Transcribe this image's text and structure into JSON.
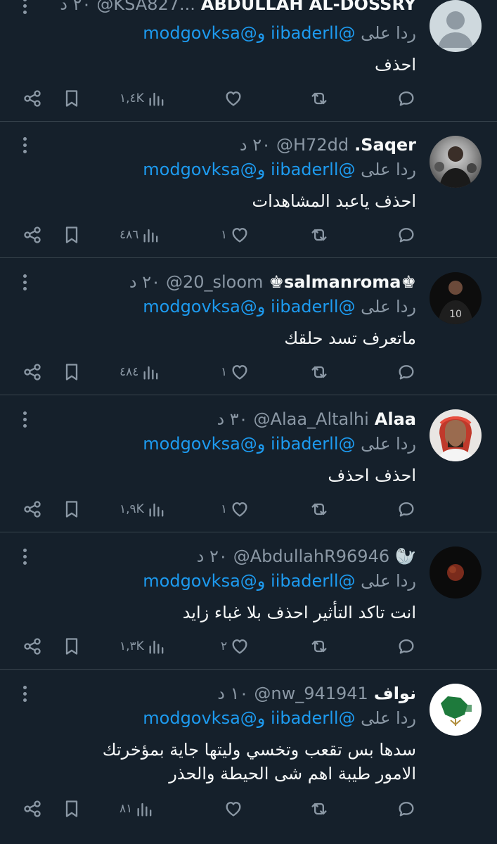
{
  "reply_label": "ردا على",
  "mention_1": "@iibaderll",
  "mention_joiner": "و",
  "mention_2": "@modgovksa",
  "tweets": [
    {
      "name": "ABDULLAH AL-DOSSRY",
      "handle": "@KSA827...",
      "time": "٢٠ د",
      "text": "احذف",
      "views": "١,٤K",
      "likes": "",
      "avatar": "default"
    },
    {
      "name": "Saqer.",
      "handle": "@H72dd",
      "time": "٢٠ د",
      "text": "احذف ياعبد المشاهدات",
      "views": "٤٨٦",
      "likes": "١",
      "avatar": "man-photo"
    },
    {
      "name": "♚salmanroma♚",
      "handle": "@20_sloom",
      "time": "٢٠ د",
      "text": "ماتعرف تسد حلقك",
      "views": "٤٨٤",
      "likes": "١",
      "avatar": "player-photo"
    },
    {
      "name": "Alaa",
      "handle": "@Alaa_Altalhi",
      "time": "٣٠ د",
      "text": "احذف احذف",
      "views": "١,٩K",
      "likes": "١",
      "avatar": "man-photo"
    },
    {
      "name": "🦭",
      "handle": "@AbdullahR96946",
      "time": "٢٠ د",
      "text": "انت تاكد التأثير احذف بلا غباء زايد",
      "views": "١,٣K",
      "likes": "٢",
      "avatar": "moon-photo"
    },
    {
      "name": "نواف",
      "handle": "@nw_941941",
      "time": "١٠ د",
      "text_lines": [
        "سدها بس تقعب وتخسي وليتها جاية بمؤخرتك",
        "الامور طيبة اهم شى الحيطة والحذر"
      ],
      "views": "٨١",
      "likes": "",
      "avatar": "emblem-logo"
    }
  ],
  "colors": {
    "background": "#15202b",
    "text": "#f7f9f9",
    "muted": "#8b98a5",
    "link": "#1d9bf0",
    "divider": "#38444d"
  },
  "icons": [
    "share-icon",
    "bookmark-icon",
    "views-icon",
    "like-icon",
    "retweet-icon",
    "reply-icon",
    "more-icon"
  ]
}
